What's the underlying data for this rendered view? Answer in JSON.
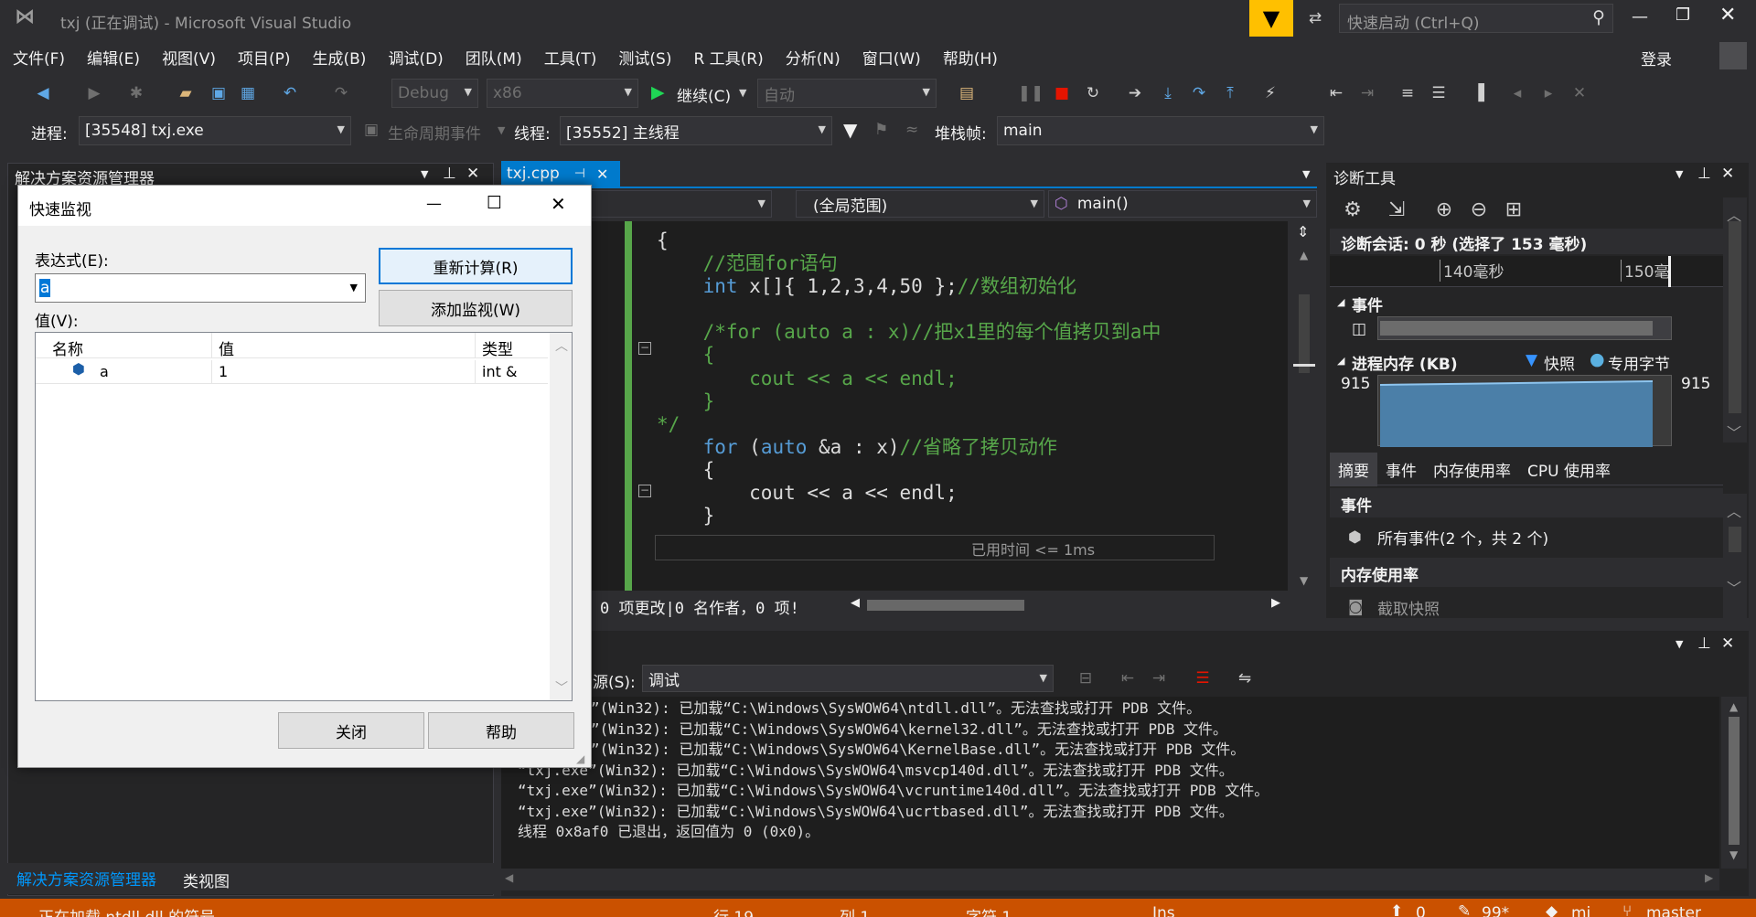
{
  "window": {
    "title": "txj (正在调试) - Microsoft Visual Studio",
    "quick_launch_placeholder": "快速启动 (Ctrl+Q)",
    "signin": "登录"
  },
  "menu": [
    "文件(F)",
    "编辑(E)",
    "视图(V)",
    "项目(P)",
    "生成(B)",
    "调试(D)",
    "团队(M)",
    "工具(T)",
    "测试(S)",
    "R 工具(R)",
    "分析(N)",
    "窗口(W)",
    "帮助(H)"
  ],
  "toolbar": {
    "config": "Debug",
    "platform": "x86",
    "continue_label": "继续(C)",
    "auto_label": "自动"
  },
  "debug_bar": {
    "process_label": "进程:",
    "process_value": "[35548] txj.exe",
    "lifecycle_label": "生命周期事件",
    "thread_label": "线程:",
    "thread_value": "[35552] 主线程",
    "stackframe_label": "堆栈帧:",
    "stackframe_value": "main"
  },
  "solution_explorer": {
    "title": "解决方案资源管理器",
    "tab_solution": "解决方案资源管理器",
    "tab_class": "类视图"
  },
  "editor": {
    "tab": "txj.cpp",
    "scope": "(全局范围)",
    "function": "main()",
    "lines": [
      {
        "t": "{",
        "c": "plain"
      },
      {
        "t": "    //范围for语句",
        "c": "comment"
      },
      {
        "t": "",
        "c": "arr"
      },
      {
        "t": "",
        "c": "blank"
      },
      {
        "t": "    /*for (auto a : x)//把x1里的每个值拷贝到a中",
        "c": "comment"
      },
      {
        "t": "    {",
        "c": "comment"
      },
      {
        "t": "        cout << a << endl;",
        "c": "comment"
      },
      {
        "t": "    }",
        "c": "comment"
      },
      {
        "t": "*/",
        "c": "comment"
      },
      {
        "t": "",
        "c": "for"
      },
      {
        "t": "    {",
        "c": "plain"
      },
      {
        "t": "        cout << a << endl;",
        "c": "current"
      },
      {
        "t": "    }",
        "c": "plain"
      }
    ],
    "arr_parts": {
      "kw": "int",
      "body": " x[]{ 1,2,3,4,50 };",
      "comment": "//数组初始化"
    },
    "for_parts": {
      "kw1": "for",
      "p1": " (",
      "kw2": "auto",
      "p2": " &a : x)",
      "comment": "//省略了拷贝动作"
    },
    "elapsed": "已用时间 <= 1ms",
    "status": "0 项更改|0 名作者，0 项!"
  },
  "diagnostics": {
    "title": "诊断工具",
    "session": "诊断会话: 0 秒 (选择了 153 毫秒)",
    "tick1": "140毫秒",
    "tick2": "150毫",
    "events_label": "事件",
    "memory_label": "进程内存 (KB)",
    "snapshot_legend": "快照",
    "private_legend": "专用字节",
    "mem_left": "915",
    "mem_right": "915",
    "tabs": [
      "摘要",
      "事件",
      "内存使用率",
      "CPU 使用率"
    ],
    "section_events": "事件",
    "all_events": "所有事件(2 个，共 2 个)",
    "section_memory": "内存使用率",
    "take_snapshot": "截取快照"
  },
  "output": {
    "source_label": "源(S):",
    "source_value": "调试",
    "lines": [
      "”(Win32): 已加载“C:\\Windows\\SysWOW64\\ntdll.dll”。无法查找或打开 PDB 文件。",
      "”(Win32): 已加载“C:\\Windows\\SysWOW64\\kernel32.dll”。无法查找或打开 PDB 文件。",
      "”(Win32): 已加载“C:\\Windows\\SysWOW64\\KernelBase.dll”。无法查找或打开 PDB 文件。",
      "“txj.exe”(Win32): 已加载“C:\\Windows\\SysWOW64\\msvcp140d.dll”。无法查找或打开 PDB 文件。",
      "“txj.exe”(Win32): 已加载“C:\\Windows\\SysWOW64\\vcruntime140d.dll”。无法查找或打开 PDB 文件。",
      "“txj.exe”(Win32): 已加载“C:\\Windows\\SysWOW64\\ucrtbased.dll”。无法查找或打开 PDB 文件。",
      "线程 0x8af0 已退出，返回值为 0 (0x0)。"
    ]
  },
  "quickwatch": {
    "title": "快速监视",
    "expr_label": "表达式(E):",
    "expr_value": "a",
    "value_label": "值(V):",
    "reeval": "重新计算(R)",
    "add_watch": "添加监视(W)",
    "col_name": "名称",
    "col_value": "值",
    "col_type": "类型",
    "row": {
      "name": "a",
      "value": "1",
      "type": "int &"
    },
    "close": "关闭",
    "help": "帮助"
  },
  "statusbar": {
    "message": "正在加载 ntdll.dll 的符号",
    "line": "行 19",
    "col": "列 1",
    "char": "字符 1",
    "ins": "Ins",
    "errors": "0",
    "pencil": "99*",
    "repo": "mi",
    "branch": "master"
  },
  "colors": {
    "accent": "#007acc",
    "status": "#ca5100",
    "keyword": "#569cd6",
    "comment": "#57a64a",
    "filter_yellow": "#ffc000"
  }
}
